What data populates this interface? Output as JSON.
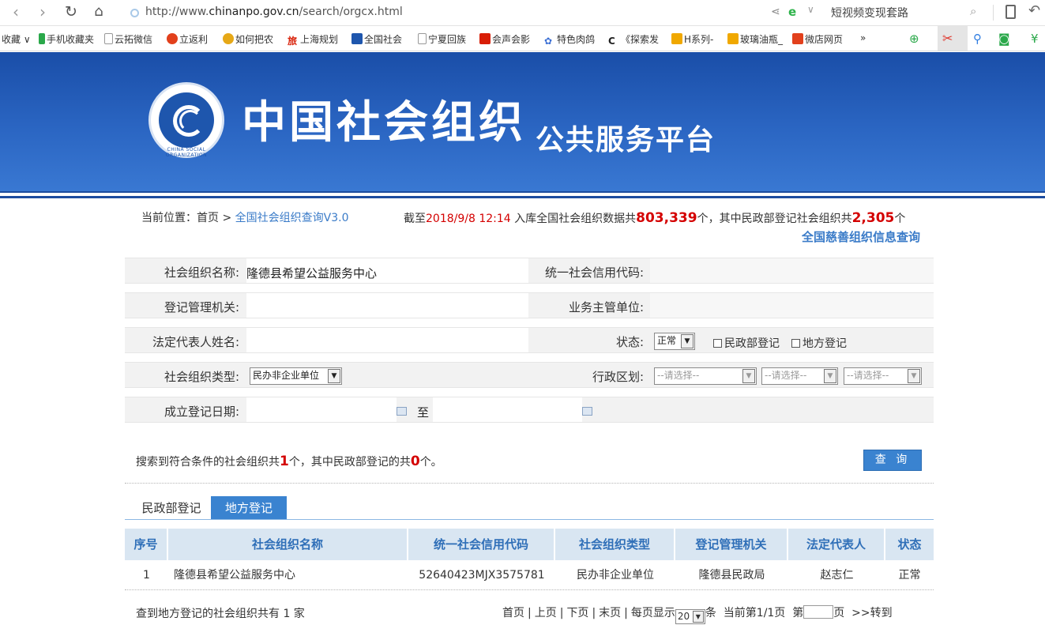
{
  "browser": {
    "url_prefix": "http://www.",
    "url_domain": "chinanpo.gov.cn",
    "url_path": "/search/orgcx.html",
    "search_box": "短视频变现套路",
    "favorites_label": "收藏",
    "favorites": [
      {
        "label": "手机收藏夹",
        "color": "#2aa84a"
      },
      {
        "label": "云拓微信",
        "color": "#cccccc"
      },
      {
        "label": "立返利",
        "color": "#e2401c"
      },
      {
        "label": "如何把农",
        "color": "#e6a817"
      },
      {
        "label": "上海规划",
        "color": "#d81e06"
      },
      {
        "label": "全国社会",
        "color": "#1e56ad"
      },
      {
        "label": "宁夏回族",
        "color": "#cccccc"
      },
      {
        "label": "会声会影",
        "color": "#d81e06"
      },
      {
        "label": "特色肉鸽",
        "color": "#3b6fd4"
      },
      {
        "label": "《探索发",
        "color": "#222222"
      },
      {
        "label": "H系列-",
        "color": "#f0a800"
      },
      {
        "label": "玻璃油瓶_",
        "color": "#f0a800"
      },
      {
        "label": "微店网页",
        "color": "#e2401c"
      }
    ],
    "more": "»"
  },
  "banner": {
    "title": "中国社会组织",
    "subtitle": "公共服务平台",
    "logo_ring": "CHINA SOCIAL ORGANIZATION"
  },
  "breadcrumb": {
    "label": "当前位置：",
    "home": "首页",
    "sep": " > ",
    "current": "全国社会组织查询V3.0"
  },
  "stats": {
    "prefix": "截至",
    "date": "2018/9/8 12:14",
    "mid": " 入库全国社会组织数据共",
    "total": "803,339",
    "mid2": "个，其中民政部登记社会组织共",
    "ministry": "2,305",
    "suffix": "个"
  },
  "charity_link": "全国慈善组织信息查询",
  "form": {
    "name_label": "社会组织名称:",
    "name_value": "隆德县希望公益服务中心",
    "credit_label": "统一社会信用代码:",
    "reg_label": "登记管理机关:",
    "supervisor_label": "业务主管单位:",
    "rep_label": "法定代表人姓名:",
    "status_label": "状态:",
    "status_value": "正常",
    "ministry_cb": "民政部登记",
    "local_cb": "地方登记",
    "type_label": "社会组织类型:",
    "type_value": "民办非企业单位",
    "region_label": "行政区划:",
    "region_placeholder": "--请选择--",
    "date_label": "成立登记日期:",
    "date_to": "至"
  },
  "result": {
    "prefix": "搜索到符合条件的社会组织共",
    "count": "1",
    "mid": "个，其中民政部登记的共",
    "ministry_count": "0",
    "suffix": "个。"
  },
  "query_button": "查 询",
  "tabs": {
    "ministry": "民政部登记",
    "local": "地方登记"
  },
  "table": {
    "headers": [
      "序号",
      "社会组织名称",
      "统一社会信用代码",
      "社会组织类型",
      "登记管理机关",
      "法定代表人",
      "状态"
    ],
    "rows": [
      [
        "1",
        "隆德县希望公益服务中心",
        "52640423MJX3575781",
        "民办非企业单位",
        "隆德县民政局",
        "赵志仁",
        "正常"
      ]
    ]
  },
  "footer": {
    "count_text": "查到地方登记的社会组织共有 1 家",
    "first": "首页",
    "prev": "上页",
    "next": "下页",
    "last": "末页",
    "per_page_label": "每页显示",
    "per_page": "20",
    "per_page_unit": "条",
    "current": "当前第1/1页",
    "goto_prefix": "第",
    "goto_suffix": "页",
    "goto": ">>转到"
  }
}
